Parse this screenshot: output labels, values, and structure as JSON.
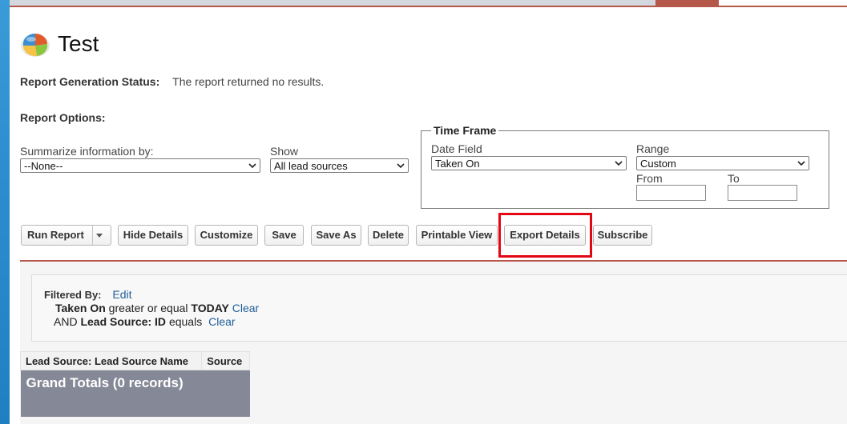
{
  "page": {
    "title": "Test",
    "status_label": "Report Generation Status:",
    "status_text": "The report returned no results.",
    "options_label": "Report Options:"
  },
  "options": {
    "summarize_label": "Summarize information by:",
    "summarize_value": "--None--",
    "show_label": "Show",
    "show_value": "All lead sources"
  },
  "timeframe": {
    "legend": "Time Frame",
    "date_field_label": "Date Field",
    "date_field_value": "Taken On",
    "range_label": "Range",
    "range_value": "Custom",
    "from_label": "From",
    "from_value": "",
    "to_label": "To",
    "to_value": ""
  },
  "toolbar": {
    "run_report": "Run Report",
    "hide_details": "Hide Details",
    "customize": "Customize",
    "save": "Save",
    "save_as": "Save As",
    "delete": "Delete",
    "printable_view": "Printable View",
    "export_details": "Export Details",
    "subscribe": "Subscribe"
  },
  "filters": {
    "label": "Filtered By:",
    "edit": "Edit",
    "f1_field": "Taken On",
    "f1_op": "greater or equal",
    "f1_value": "TODAY",
    "f1_clear": "Clear",
    "f2_prefix": "AND",
    "f2_field": "Lead Source: ID",
    "f2_op": "equals",
    "f2_clear": "Clear"
  },
  "table": {
    "columns": [
      "Lead Source: Lead Source Name",
      "Source"
    ],
    "grand_totals": "Grand Totals (0 records)"
  },
  "colors": {
    "accent": "#b5584a",
    "highlight": "#e30613",
    "link": "#1f5f9a",
    "totals_bg": "#858896"
  },
  "icons": {
    "report": "report-pie-chart-icon",
    "dropdown": "chevron-down-icon"
  }
}
